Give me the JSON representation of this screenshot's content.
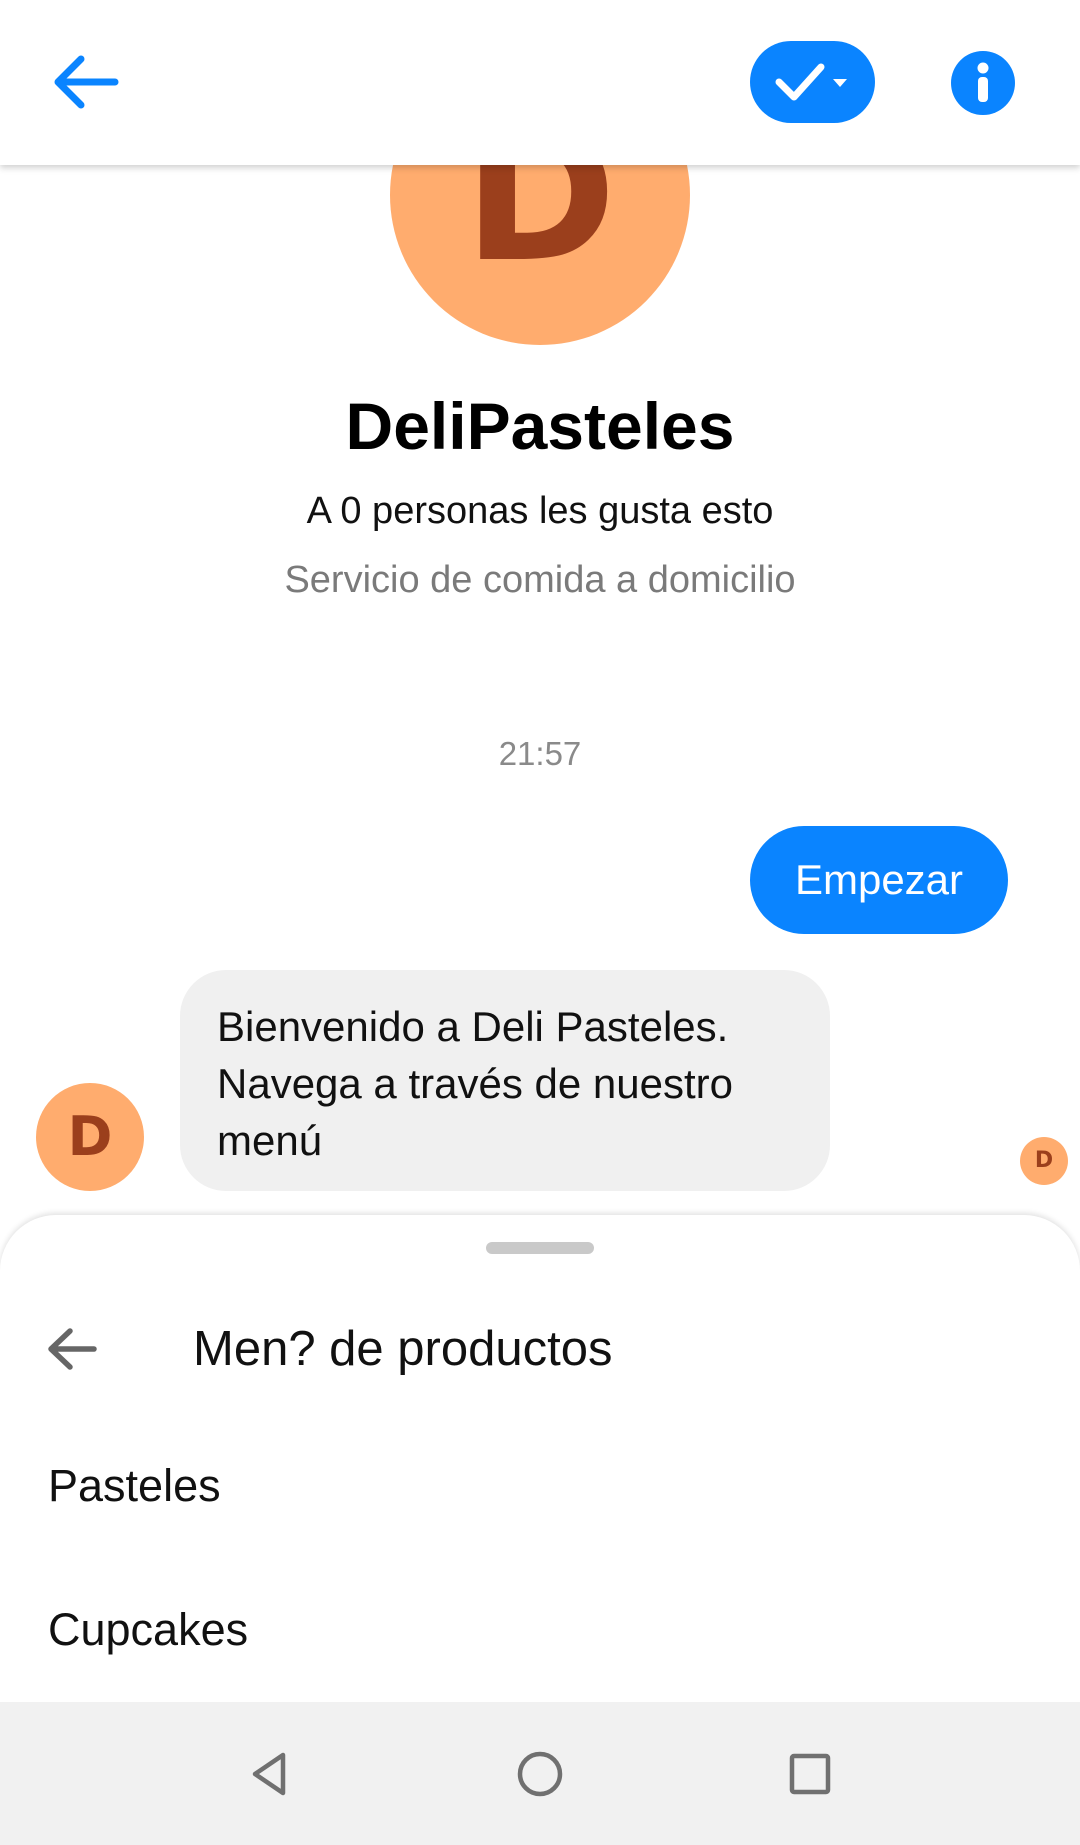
{
  "header": {
    "back_icon": "arrow-left-icon",
    "status_icon": "checkmark-dropdown-icon",
    "info_icon": "info-circle-icon",
    "accent_color": "#0a84ff"
  },
  "profile": {
    "avatar_initial": "D",
    "avatar_color": "#ffac6e",
    "avatar_text_color": "#9b3f1c",
    "name": "DeliPasteles",
    "likes": "A 0 personas les gusta esto",
    "category": "Servicio de comida a domicilio"
  },
  "conversation": {
    "timestamp": "21:57",
    "messages": [
      {
        "direction": "outgoing",
        "text": "Empezar"
      },
      {
        "direction": "incoming",
        "sender_initial": "D",
        "text": "Bienvenido a Deli Pasteles. Navega a través de nuestro menú"
      }
    ],
    "seen_initial": "D"
  },
  "menu_sheet": {
    "back_icon": "arrow-left-icon",
    "title": "Men? de productos",
    "items": [
      {
        "label": "Pasteles"
      },
      {
        "label": "Cupcakes"
      }
    ]
  },
  "system_nav": {
    "back_icon": "triangle-back-icon",
    "home_icon": "circle-home-icon",
    "recents_icon": "square-recents-icon"
  }
}
